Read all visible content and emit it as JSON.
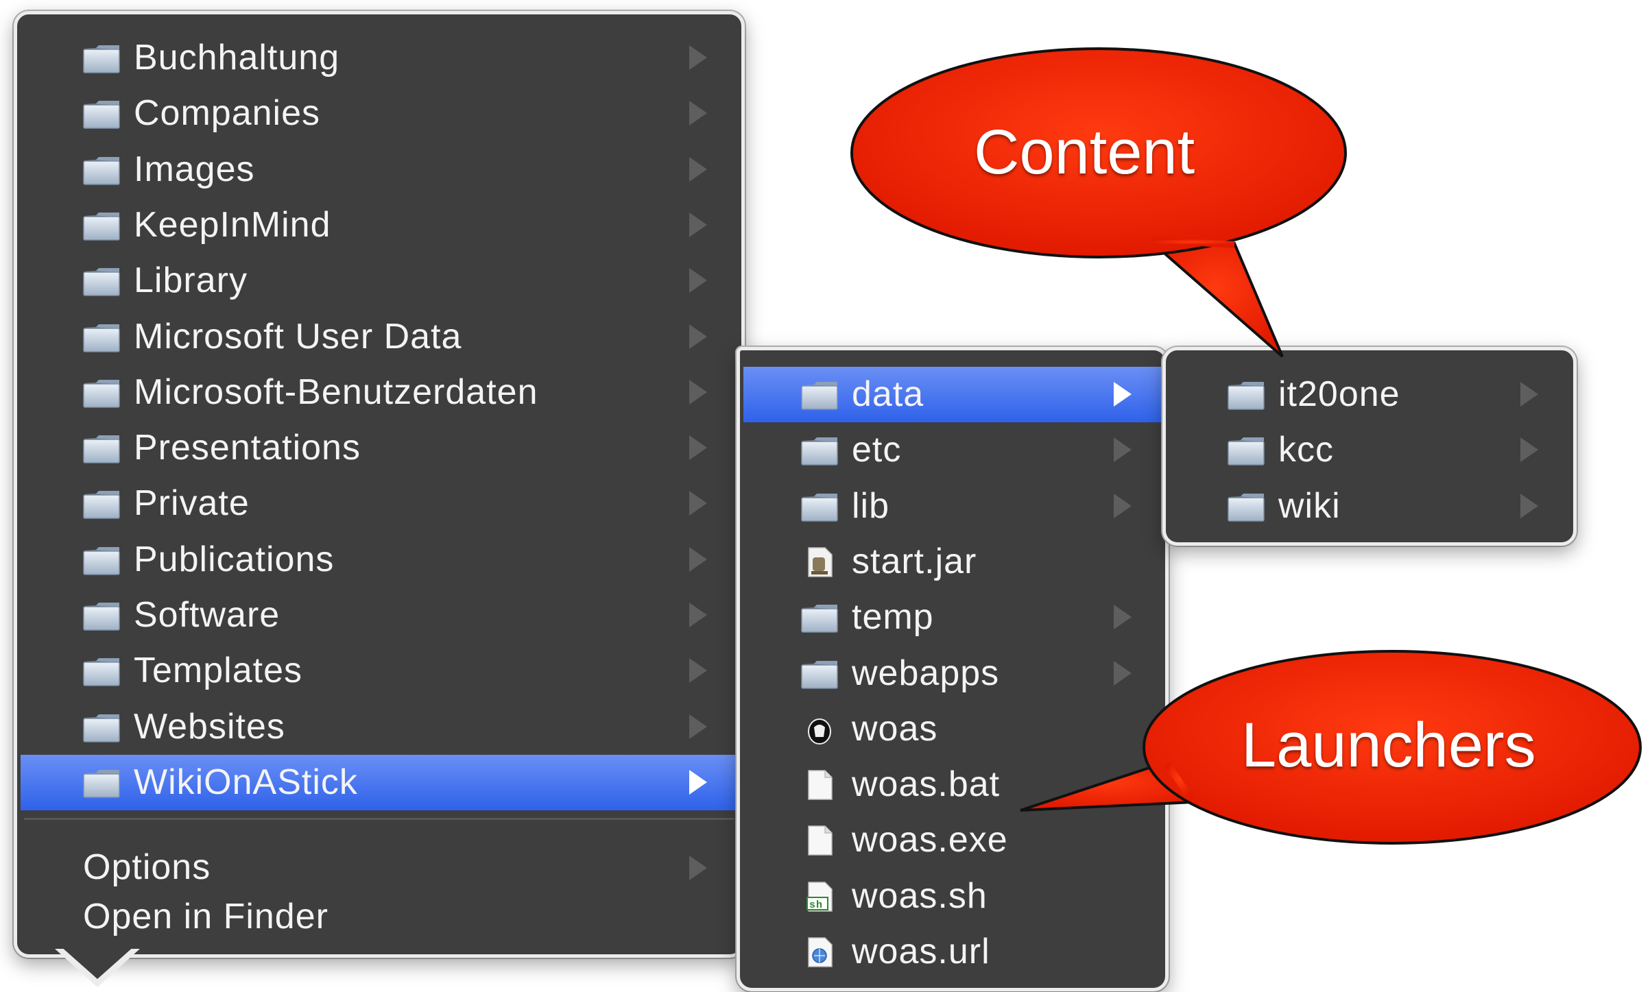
{
  "colors": {
    "menu_bg": "#3e3e3e",
    "selection": "#2f62ea",
    "callout_fill": "#ee2200",
    "text": "#f4f4f4"
  },
  "main_menu": {
    "items": [
      {
        "label": "Buchhaltung",
        "icon": "folder-icon",
        "submenu": true
      },
      {
        "label": "Companies",
        "icon": "folder-icon",
        "submenu": true
      },
      {
        "label": "Images",
        "icon": "folder-icon",
        "submenu": true
      },
      {
        "label": "KeepInMind",
        "icon": "folder-icon",
        "submenu": true
      },
      {
        "label": "Library",
        "icon": "folder-icon",
        "submenu": true
      },
      {
        "label": "Microsoft User Data",
        "icon": "folder-icon",
        "submenu": true
      },
      {
        "label": "Microsoft-Benutzerdaten",
        "icon": "folder-icon",
        "submenu": true
      },
      {
        "label": "Presentations",
        "icon": "folder-icon",
        "submenu": true
      },
      {
        "label": "Private",
        "icon": "folder-icon",
        "submenu": true
      },
      {
        "label": "Publications",
        "icon": "folder-icon",
        "submenu": true
      },
      {
        "label": "Software",
        "icon": "folder-icon",
        "submenu": true
      },
      {
        "label": "Templates",
        "icon": "folder-icon",
        "submenu": true
      },
      {
        "label": "Websites",
        "icon": "folder-icon",
        "submenu": true
      },
      {
        "label": "WikiOnAStick",
        "icon": "folder-icon",
        "submenu": true,
        "selected": true
      }
    ],
    "options_label": "Options",
    "open_in_finder_label": "Open in Finder"
  },
  "sub_menu": {
    "items": [
      {
        "label": "data",
        "icon": "folder-icon",
        "submenu": true,
        "selected": true
      },
      {
        "label": "etc",
        "icon": "folder-icon",
        "submenu": true
      },
      {
        "label": "lib",
        "icon": "folder-icon",
        "submenu": true
      },
      {
        "label": "start.jar",
        "icon": "jar-file-icon",
        "submenu": false
      },
      {
        "label": "temp",
        "icon": "folder-icon",
        "submenu": true
      },
      {
        "label": "webapps",
        "icon": "folder-icon",
        "submenu": true
      },
      {
        "label": "woas",
        "icon": "app-icon",
        "submenu": false
      },
      {
        "label": "woas.bat",
        "icon": "document-icon",
        "submenu": false
      },
      {
        "label": "woas.exe",
        "icon": "document-icon",
        "submenu": false
      },
      {
        "label": "woas.sh",
        "icon": "shell-script-icon",
        "submenu": false
      },
      {
        "label": "woas.url",
        "icon": "url-file-icon",
        "submenu": false
      }
    ]
  },
  "sub2_menu": {
    "items": [
      {
        "label": "it20one",
        "icon": "folder-icon",
        "submenu": true
      },
      {
        "label": "kcc",
        "icon": "folder-icon",
        "submenu": true
      },
      {
        "label": "wiki",
        "icon": "folder-icon",
        "submenu": true
      }
    ]
  },
  "callouts": {
    "content_label": "Content",
    "launchers_label": "Launchers"
  }
}
